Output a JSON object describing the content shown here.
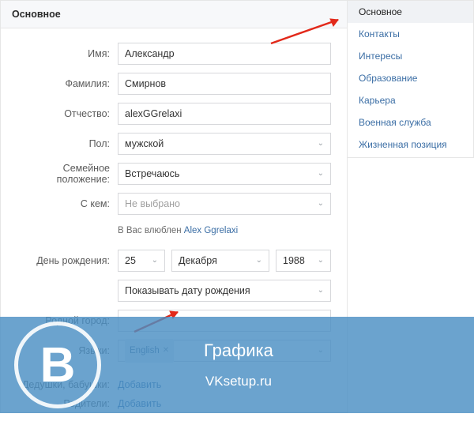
{
  "header": {
    "title": "Основное"
  },
  "labels": {
    "name": "Имя:",
    "surname": "Фамилия:",
    "middlename": "Отчество:",
    "gender": "Пол:",
    "relationship": "Семейное положение:",
    "partner": "С кем:",
    "birthday": "День рождения:",
    "hometown": "Родной город:",
    "languages": "Языки:",
    "grandparents": "Дедушки, бабушки:",
    "parents": "Родители:"
  },
  "values": {
    "name": "Александр",
    "surname": "Смирнов",
    "middlename": "alexGGrelaxi",
    "gender": "мужской",
    "relationship": "Встречаюсь",
    "partner": "Не выбрано",
    "birthday_day": "25",
    "birthday_month": "Декабря",
    "birthday_year": "1988",
    "birthday_visibility": "Показывать дату рождения",
    "hometown": "",
    "language_token": "English",
    "add_link": "Добавить"
  },
  "note": {
    "prefix": "В Вас влюблен ",
    "link": "Alex Ggrelaxi"
  },
  "sidebar": {
    "items": [
      {
        "label": "Основное",
        "active": true
      },
      {
        "label": "Контакты",
        "active": false
      },
      {
        "label": "Интересы",
        "active": false
      },
      {
        "label": "Образование",
        "active": false
      },
      {
        "label": "Карьера",
        "active": false
      },
      {
        "label": "Военная служба",
        "active": false
      },
      {
        "label": "Жизненная позиция",
        "active": false
      }
    ]
  },
  "overlay": {
    "logo_letter": "В",
    "line1": "Графика",
    "line2": "VKsetup.ru"
  }
}
